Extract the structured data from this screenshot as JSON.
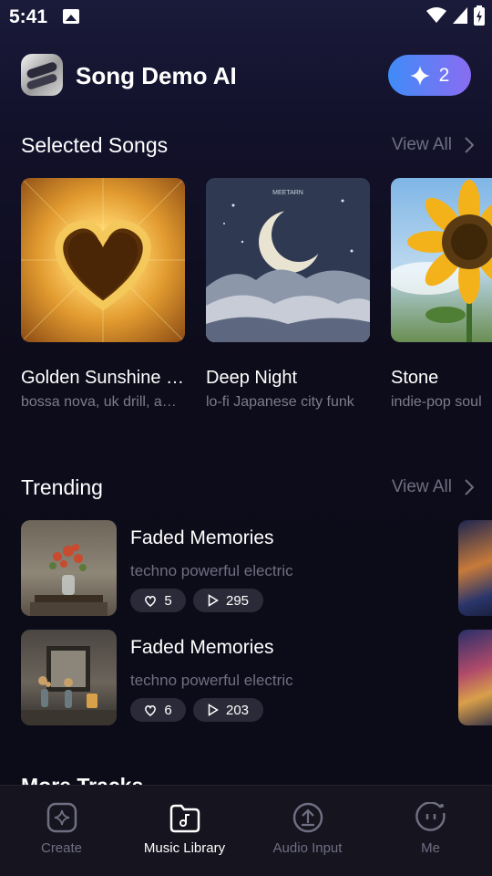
{
  "status_bar": {
    "time": "5:41"
  },
  "header": {
    "app_name": "Song Demo AI",
    "credits": "2"
  },
  "selected_songs": {
    "title": "Selected Songs",
    "view_all": "View All",
    "items": [
      {
        "title": "Golden Sunshine Reflections",
        "tags": "bossa nova, uk drill, ambient"
      },
      {
        "title": "Deep Night",
        "tags": "lo-fi Japanese city funk"
      },
      {
        "title": "Stone",
        "tags": "indie-pop soul"
      }
    ],
    "cover_caption": "MEETARN"
  },
  "trending": {
    "title": "Trending",
    "view_all": "View All",
    "items": [
      {
        "title": "Faded Memories",
        "tags": "techno powerful electric",
        "likes": "5",
        "plays": "295"
      },
      {
        "title": "Faded Memories",
        "tags": "techno powerful electric",
        "likes": "6",
        "plays": "203"
      }
    ]
  },
  "more_tracks": {
    "title": "More Tracks"
  },
  "bottom_nav": {
    "items": [
      {
        "label": "Create",
        "icon": "sparkle-icon",
        "active": false
      },
      {
        "label": "Music Library",
        "icon": "music-folder-icon",
        "active": true
      },
      {
        "label": "Audio Input",
        "icon": "upload-icon",
        "active": false
      },
      {
        "label": "Me",
        "icon": "profile-face-icon",
        "active": false
      }
    ]
  },
  "colors": {
    "accent_start": "#3f8cf7",
    "accent_end": "#8a6cf2",
    "muted_text": "#6f6f82",
    "background": "#0d0c1a"
  }
}
